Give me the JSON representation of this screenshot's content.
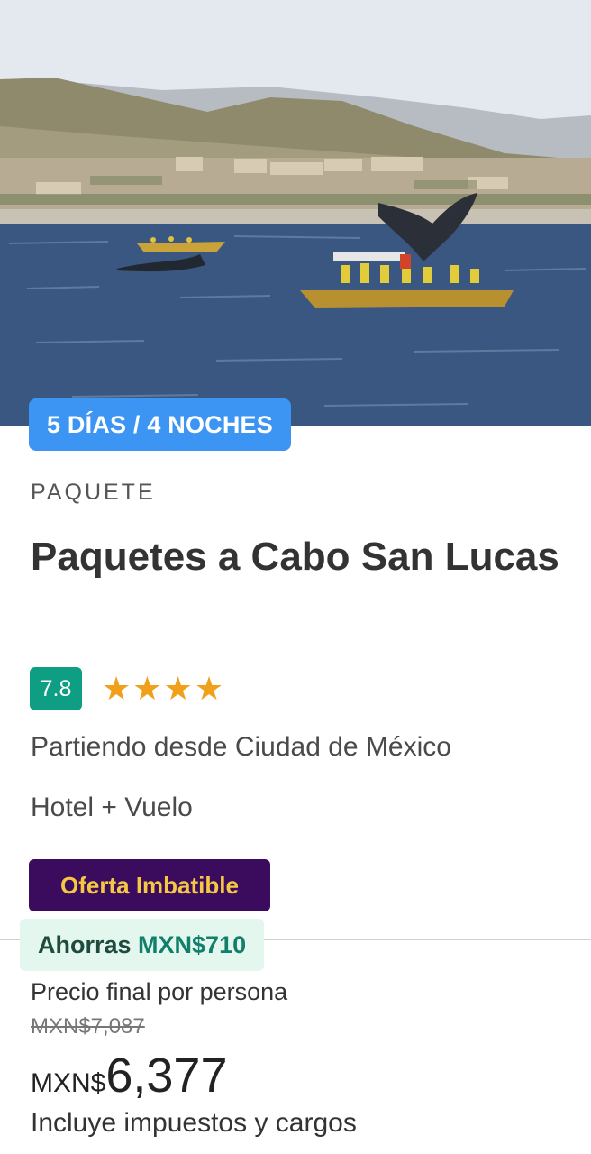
{
  "hero": {
    "image": "whale-watching-boats-cabo-san-lucas",
    "duration_badge": "5 DÍAS / 4 NOCHES"
  },
  "package": {
    "category": "PAQUETE",
    "title": "Paquetes a Cabo San Lucas",
    "rating_score": "7.8",
    "stars_text": "★★★★",
    "star_count": 4,
    "origin": "Partiendo desde Ciudad de México",
    "includes": "Hotel + Vuelo"
  },
  "offer": {
    "badge": "Oferta Imbatible",
    "savings_label": "Ahorras",
    "savings_amount": "MXN$710"
  },
  "pricing": {
    "label": "Precio final por persona",
    "old_price": "MXN$7,087",
    "currency": "MXN$",
    "price": "6,377",
    "taxes_note": "Incluye impuestos y cargos"
  },
  "colors": {
    "duration_badge": "#3c95f2",
    "rating_badge": "#0e9e83",
    "stars": "#f0a01a",
    "deal_badge_bg": "#3b0b5e",
    "deal_badge_text": "#f5c844",
    "savings_bg": "#e3f7ef"
  }
}
